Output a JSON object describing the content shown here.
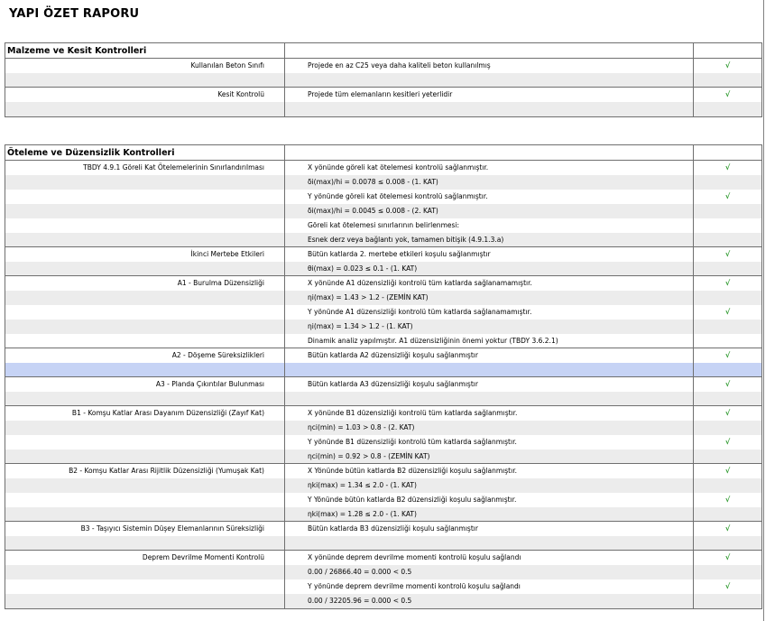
{
  "report_title": "YAPI ÖZET RAPORU",
  "check_mark": "√",
  "colors": {
    "check": "#2e9a2e",
    "row_shade": "#ececec",
    "row_highlight": "#c6d3f5",
    "border": "#6f6f6f"
  },
  "sections": [
    {
      "title": "Malzeme ve Kesit Kontrolleri",
      "groups": [
        {
          "label": "Kullanılan Beton Sınıfı",
          "lines": [
            {
              "text": "Projede en az C25 veya daha kaliteli beton kullanılmış",
              "check": true,
              "shade": false
            },
            {
              "text": "",
              "check": false,
              "shade": true
            }
          ]
        },
        {
          "label": "Kesit Kontrolü",
          "lines": [
            {
              "text": "Projede tüm elemanların kesitleri yeterlidir",
              "check": true,
              "shade": false
            },
            {
              "text": "",
              "check": false,
              "shade": true
            }
          ]
        }
      ]
    },
    {
      "title": "Öteleme ve Düzensizlik Kontrolleri",
      "groups": [
        {
          "label": "TBDY 4.9.1 Göreli Kat Ötelemelerinin Sınırlandırılması",
          "lines": [
            {
              "text": "X yönünde göreli kat ötelemesi kontrolü sağlanmıştır.",
              "check": true,
              "shade": false
            },
            {
              "text": "δi(max)/hi  = 0.0078 ≤ 0.008 - (1. KAT)",
              "check": false,
              "shade": true
            },
            {
              "text": "Y yönünde göreli kat ötelemesi kontrolü sağlanmıştır.",
              "check": true,
              "shade": false
            },
            {
              "text": "δi(max)/hi  = 0.0045 ≤ 0.008 - (2. KAT)",
              "check": false,
              "shade": true
            },
            {
              "text": "Göreli kat ötelemesi sınırlarının belirlenmesi:",
              "check": false,
              "shade": false
            },
            {
              "text": "Esnek derz veya bağlantı yok, tamamen bitişik (4.9.1.3.a)",
              "check": false,
              "shade": true
            }
          ]
        },
        {
          "label": "İkinci Mertebe Etkileri",
          "lines": [
            {
              "text": "Bütün katlarda 2. mertebe etkileri koşulu sağlanmıştır",
              "check": true,
              "shade": false
            },
            {
              "text": "θi(max) = 0.023 ≤ 0.1 - (1. KAT)",
              "check": false,
              "shade": true
            }
          ]
        },
        {
          "label": "A1 - Burulma Düzensizliği",
          "lines": [
            {
              "text": "X yönünde A1 düzensizliği kontrolü tüm katlarda sağlanamamıştır.",
              "check": true,
              "shade": false
            },
            {
              "text": "ηi(max) = 1.43 > 1.2 - (ZEMİN KAT)",
              "check": false,
              "shade": true
            },
            {
              "text": "Y yönünde A1 düzensizliği kontrolü tüm katlarda sağlanamamıştır.",
              "check": true,
              "shade": false
            },
            {
              "text": "ηi(max) = 1.34 > 1.2 - (1. KAT)",
              "check": false,
              "shade": true
            },
            {
              "text": "Dinamik analiz yapılmıştır. A1 düzensizliğinin önemi yoktur (TBDY 3.6.2.1)",
              "check": false,
              "shade": false
            }
          ]
        },
        {
          "label": "A2 - Döşeme Süreksizlikleri",
          "lines": [
            {
              "text": "Bütün katlarda A2 düzensizliği koşulu sağlanmıştır",
              "check": true,
              "shade": false
            },
            {
              "text": "",
              "check": false,
              "shade": false,
              "highlight": true
            }
          ]
        },
        {
          "label": "A3 - Planda Çıkıntılar Bulunması",
          "lines": [
            {
              "text": "Bütün katlarda A3 düzensizliği koşulu sağlanmıştır",
              "check": true,
              "shade": false
            },
            {
              "text": "",
              "check": false,
              "shade": true
            }
          ]
        },
        {
          "label": "B1 - Komşu Katlar Arası Dayanım Düzensizliği (Zayıf Kat)",
          "lines": [
            {
              "text": "X yönünde B1 düzensizliği kontrolü tüm katlarda sağlanmıştır.",
              "check": true,
              "shade": false
            },
            {
              "text": "ηci(min) = 1.03 > 0.8 - (2. KAT)",
              "check": false,
              "shade": true
            },
            {
              "text": "Y yönünde B1 düzensizliği kontrolü tüm katlarda sağlanmıştır.",
              "check": true,
              "shade": false
            },
            {
              "text": "ηci(min) = 0.92 > 0.8 - (ZEMİN KAT)",
              "check": false,
              "shade": true
            }
          ]
        },
        {
          "label": "B2 - Komşu Katlar Arası Rijitlik Düzensizliği (Yumuşak Kat)",
          "lines": [
            {
              "text": "X Yönünde bütün katlarda B2 düzensizliği koşulu sağlanmıştır.",
              "check": true,
              "shade": false
            },
            {
              "text": "ηki(max) = 1.34 ≤ 2.0 - (1. KAT)",
              "check": false,
              "shade": true
            },
            {
              "text": "Y Yönünde bütün katlarda B2 düzensizliği koşulu sağlanmıştır.",
              "check": true,
              "shade": false
            },
            {
              "text": "ηki(max) = 1.28 ≤ 2.0 - (1. KAT)",
              "check": false,
              "shade": true
            }
          ]
        },
        {
          "label": "B3 - Taşıyıcı Sistemin Düşey Elemanlarının Süreksizliği",
          "lines": [
            {
              "text": "Bütün katlarda B3 düzensizliği koşulu sağlanmıştır",
              "check": true,
              "shade": false
            },
            {
              "text": "",
              "check": false,
              "shade": true
            }
          ]
        },
        {
          "label": "Deprem Devrilme Momenti Kontrolü",
          "lines": [
            {
              "text": "X yönünde deprem devrilme momenti kontrolü koşulu sağlandı",
              "check": true,
              "shade": false
            },
            {
              "text": "0.00 / 26866.40 = 0.000 < 0.5",
              "check": false,
              "shade": true
            },
            {
              "text": "Y yönünde deprem devrilme momenti kontrolü koşulu sağlandı",
              "check": true,
              "shade": false
            },
            {
              "text": "0.00 / 32205.96 = 0.000 < 0.5",
              "check": false,
              "shade": true
            }
          ]
        }
      ]
    }
  ]
}
